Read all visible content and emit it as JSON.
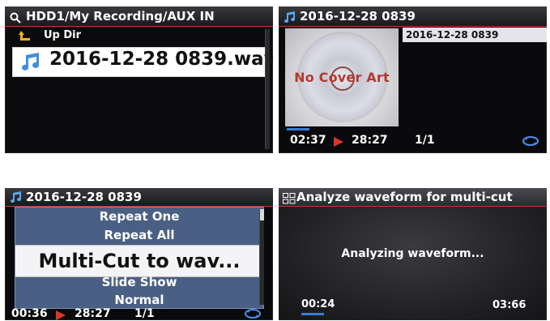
{
  "panel1": {
    "path": "HDD1/My Recording/AUX IN",
    "up_dir": "Up Dir",
    "file": "2016-12-28 0839.wav",
    "icons": [
      "search-icon",
      "up-arrow-icon",
      "music-note-icon"
    ]
  },
  "panel2": {
    "title": "2016-12-28 0839",
    "cover_text": "No Cover Art",
    "list_item": "2016-12-28 0839",
    "elapsed": "02:37",
    "total": "28:27",
    "track": "1/1",
    "progress": 0.092,
    "icons": [
      "music-note-icon",
      "play-icon",
      "repeat-icon"
    ]
  },
  "panel3": {
    "title": "2016-12-28 0839",
    "menu": [
      "Repeat One",
      "Repeat All",
      "Multi-Cut to wav...",
      "Slide Show",
      "Normal"
    ],
    "selected_index": 2,
    "elapsed": "00:36",
    "total": "28:27",
    "track": "1/1",
    "icons": [
      "music-note-icon",
      "play-icon",
      "repeat-icon"
    ]
  },
  "panel4": {
    "title": "Analyze waveform for multi-cut",
    "message": "Analyzing waveform...",
    "elapsed": "00:24",
    "total": "03:66",
    "icons": [
      "waveform-grid-icon"
    ]
  },
  "colors": {
    "accent_red": "#d8372a",
    "progress_blue": "#3b7bd6",
    "menu_blue": "#4a5f84"
  }
}
